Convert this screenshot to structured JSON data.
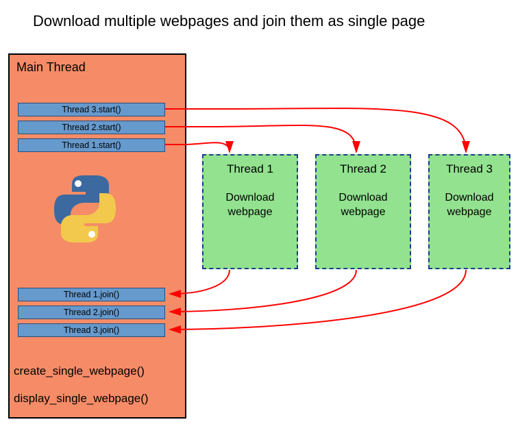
{
  "title": "Download multiple webpages and join them as single page",
  "main_thread": {
    "label": "Main Thread",
    "start_calls": [
      "Thread 3.start()",
      "Thread 2.start()",
      "Thread 1.start()"
    ],
    "join_calls": [
      "Thread 1.join()",
      "Thread 2.join()",
      "Thread 3.join()"
    ],
    "fn_calls": [
      "create_single_webpage()",
      "display_single_webpage()"
    ],
    "logo_name": "python-logo"
  },
  "threads": [
    {
      "title": "Thread 1",
      "task_l1": "Download",
      "task_l2": "webpage"
    },
    {
      "title": "Thread 2",
      "task_l1": "Download",
      "task_l2": "webpage"
    },
    {
      "title": "Thread 3",
      "task_l1": "Download",
      "task_l2": "webpage"
    }
  ],
  "colors": {
    "main_bg": "#f58c67",
    "bar_bg": "#6699cc",
    "thread_bg": "#92e28f",
    "thread_border": "#1a3b8a",
    "arrow": "#ff0000"
  }
}
